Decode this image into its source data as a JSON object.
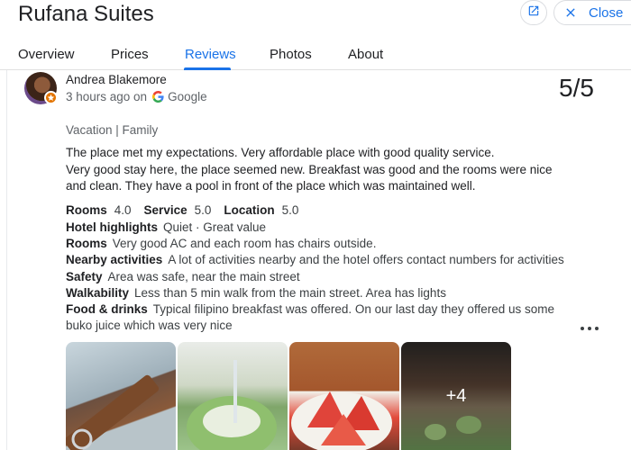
{
  "header": {
    "title": "Rufana Suites",
    "close_label": "Close"
  },
  "tabs": [
    "Overview",
    "Prices",
    "Reviews",
    "Photos",
    "About"
  ],
  "active_tab": "Reviews",
  "review": {
    "author": "Andrea Blakemore",
    "time": "3 hours ago on",
    "source": "Google",
    "score": "5/5",
    "trip_type": "Vacation | Family",
    "text_line1": "The place met my expectations. Very affordable place with good quality service.",
    "text_line2": "Very good stay here, the place seemed new. Breakfast was good and the rooms were nice and clean. They have a pool in front of the place which was maintained well.",
    "ratings": [
      {
        "label": "Rooms",
        "value": "4.0"
      },
      {
        "label": "Service",
        "value": "5.0"
      },
      {
        "label": "Location",
        "value": "5.0"
      }
    ],
    "details": [
      {
        "label": "Hotel highlights",
        "value": "Quiet · Great value"
      },
      {
        "label": "Rooms",
        "value": "Very good AC and each room has chairs outside."
      },
      {
        "label": "Nearby activities",
        "value": "A lot of activities nearby and the hotel offers contact numbers for activities"
      },
      {
        "label": "Safety",
        "value": "Area was safe, near the main street"
      },
      {
        "label": "Walkability",
        "value": "Less than 5 min walk from the main street. Area has lights"
      },
      {
        "label": "Food & drinks",
        "value": "Typical filipino breakfast was offered. On our last day they offered us some buko juice which was very nice"
      }
    ],
    "photos_more": "+4"
  },
  "icons": {
    "open": "open-in-new-icon",
    "close": "close-icon",
    "google": "google-logo-icon",
    "more": "more-horiz-icon",
    "badge": "local-guide-star-icon"
  },
  "colors": {
    "accent": "#1a73e8",
    "text": "#202124",
    "secondary": "#5f6368",
    "badge": "#e37400"
  }
}
